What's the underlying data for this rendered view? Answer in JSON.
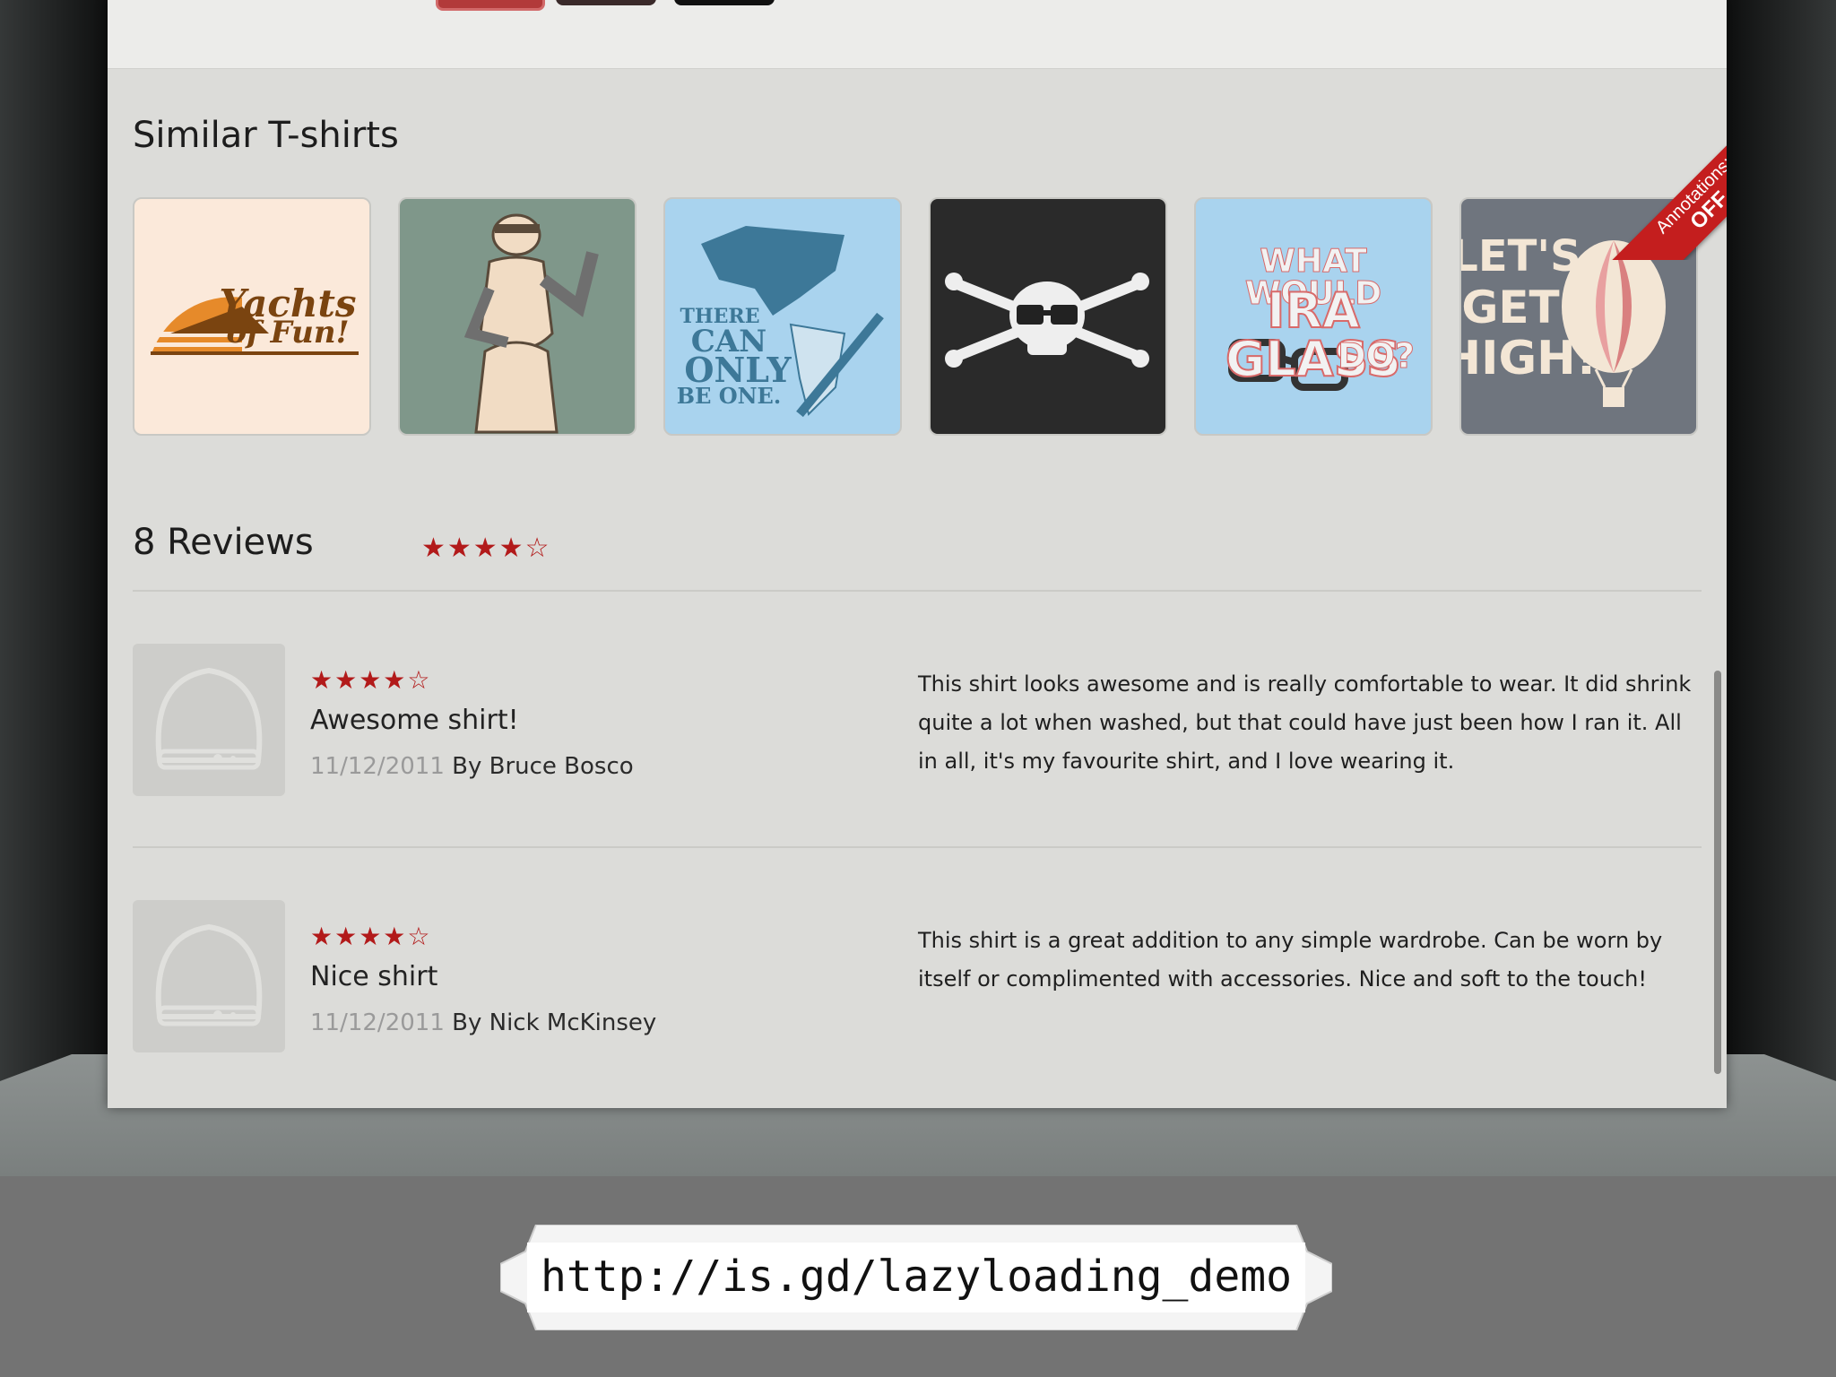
{
  "similar": {
    "title": "Similar T-shirts",
    "tiles": [
      {
        "name": "yachts-of-fun",
        "text": [
          "Yachts",
          "of Fun!"
        ]
      },
      {
        "name": "venus-robot"
      },
      {
        "name": "there-can-only-be-one",
        "text": [
          "THERE",
          "CAN",
          "ONLY",
          "BE ONE."
        ]
      },
      {
        "name": "skull-crossbones"
      },
      {
        "name": "ira-glass",
        "text": [
          "WHAT WOULD",
          "IRA GLASS",
          "DO?"
        ]
      },
      {
        "name": "lets-get-high",
        "text": [
          "LET'S",
          "GET",
          "HIGH!"
        ]
      }
    ]
  },
  "ribbon": {
    "line1": "Annotations:",
    "line2": "OFF"
  },
  "reviews": {
    "header": "8 Reviews",
    "rating": 4,
    "max_rating": 5,
    "stars_text": "★★★★☆",
    "items": [
      {
        "stars_text": "★★★★☆",
        "rating": 4,
        "title": "Awesome shirt!",
        "date": "11/12/2011",
        "by": "By Bruce Bosco",
        "body": "This shirt looks awesome and is really comfortable to wear. It did shrink quite a lot when washed, but that could have just been how I ran it. All in all, it's my favourite shirt, and I love wearing it."
      },
      {
        "stars_text": "★★★★☆",
        "rating": 4,
        "title": "Nice shirt",
        "date": "11/12/2011",
        "by": "By Nick McKinsey",
        "body": "This shirt is a great addition to any simple wardrobe. Can be worn by itself or complimented with accessories. Nice and soft to the touch!"
      }
    ]
  },
  "url": "http://is.gd/lazyloading_demo",
  "colors": {
    "star": "#b21a1a",
    "ribbon": "#c41e1e"
  }
}
